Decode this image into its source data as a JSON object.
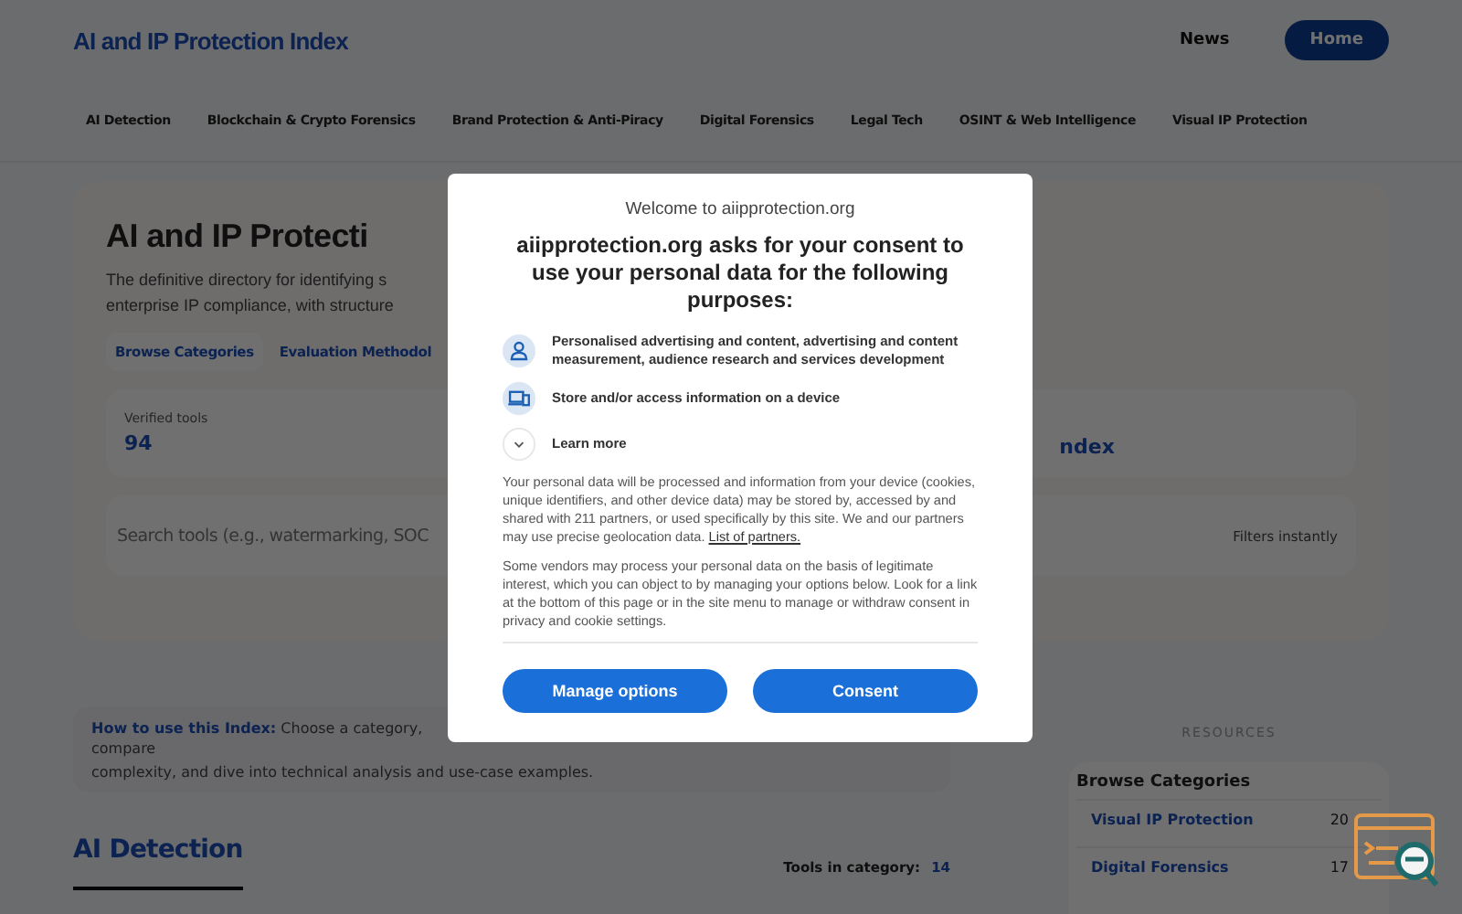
{
  "header": {
    "logo": "AI and IP Protection Index",
    "nav_links": [
      {
        "label": "News",
        "selected": false
      },
      {
        "label": "Home",
        "selected": true
      }
    ]
  },
  "categories": [
    "AI Detection",
    "Blockchain & Crypto Forensics",
    "Brand Protection & Anti-Piracy",
    "Digital Forensics",
    "Legal Tech",
    "OSINT & Web Intelligence",
    "Visual IP Protection"
  ],
  "hero": {
    "title": "AI and IP Protecti",
    "description_lines": [
      "The definitive directory for identifying s",
      "enterprise IP compliance, with structure"
    ],
    "buttons": [
      "Browse Categories",
      "Evaluation Methodol"
    ],
    "stat_label": "Verified tools",
    "stat_value": "94",
    "stat_value_2": "ndex",
    "search": {
      "placeholder": "Search tools (e.g., watermarking, SOC",
      "hint": "Filters instantly"
    }
  },
  "info": {
    "line_1": "**How to use this Index:** Choose a category, compare",
    "line_2": "complexity, and dive into technical analysis and use-case examples."
  },
  "section": {
    "title": "AI Detection",
    "count_label": "Tools in category:",
    "count": "14"
  },
  "sidebar": {
    "label": "RESOURCES",
    "title": "Browse Categories",
    "items": [
      {
        "name": "Visual IP Protection",
        "count": "20"
      },
      {
        "name": "Digital Forensics",
        "count": "17"
      }
    ]
  },
  "consent": {
    "site": "Welcome to aiipprotection.org",
    "heading": "aiipprotection.org asks for your consent to use your personal data for the following purposes:",
    "purposes": [
      {
        "kind": "person",
        "text": "Personalised advertising and content, advertising and content measurement, audience research and services development"
      },
      {
        "kind": "device",
        "text": "Store and/or access information on a device"
      }
    ],
    "learn_more": "Learn more",
    "paragraph_1": "Your personal data will be processed and information from your device (cookies, unique identifiers, and other device data) may be stored by, accessed by and shared with 211 partners, or used specifically by this site. We and our partners may use precise geolocation data.",
    "partners_link": "List of partners.",
    "paragraph_2": "Some vendors may process your personal data on the basis of legitimate interest, which you can object to by managing your options below. Look for a link at the bottom of this page or in the site menu to manage or withdraw consent in privacy and cookie settings.",
    "buttons": [
      "Manage options",
      "Consent"
    ]
  }
}
